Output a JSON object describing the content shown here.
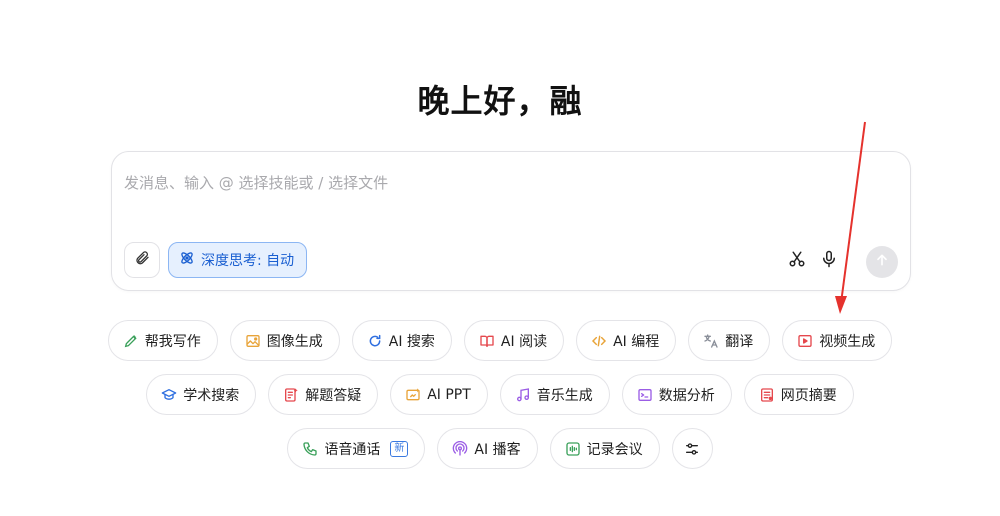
{
  "greeting": "晚上好，融",
  "composer": {
    "placeholder": "发消息、输入 @ 选择技能或 / 选择文件",
    "value": "",
    "deep_think_label": "深度思考: 自动"
  },
  "chips_row1": [
    {
      "label": "帮我写作",
      "icon": "pen-icon",
      "color": "#3aa05a"
    },
    {
      "label": "图像生成",
      "icon": "image-icon",
      "color": "#e8a43a"
    },
    {
      "label": "AI 搜索",
      "icon": "search-refresh-icon",
      "color": "#2f6fe0"
    },
    {
      "label": "AI 阅读",
      "icon": "book-icon",
      "color": "#e5484d"
    },
    {
      "label": "AI 编程",
      "icon": "code-icon",
      "color": "#e8a43a"
    },
    {
      "label": "翻译",
      "icon": "translate-icon",
      "color": "#8a8f99"
    },
    {
      "label": "视频生成",
      "icon": "video-icon",
      "color": "#e5484d"
    }
  ],
  "chips_row2": [
    {
      "label": "学术搜索",
      "icon": "graduation-cap-icon",
      "color": "#2f6fe0"
    },
    {
      "label": "解题答疑",
      "icon": "question-doc-icon",
      "color": "#e5484d"
    },
    {
      "label": "AI PPT",
      "icon": "ppt-icon",
      "color": "#e8a43a"
    },
    {
      "label": "音乐生成",
      "icon": "music-icon",
      "color": "#9b5de5"
    },
    {
      "label": "数据分析",
      "icon": "terminal-icon",
      "color": "#9b5de5"
    },
    {
      "label": "网页摘要",
      "icon": "webpage-icon",
      "color": "#e5484d"
    }
  ],
  "chips_row3": [
    {
      "label": "语音通话",
      "icon": "phone-icon",
      "color": "#3aa05a",
      "badge": "新"
    },
    {
      "label": "AI 播客",
      "icon": "podcast-icon",
      "color": "#9b5de5"
    },
    {
      "label": "记录会议",
      "icon": "meeting-icon",
      "color": "#3aa05a"
    }
  ],
  "colors": {
    "accent": "#1a5fd1",
    "annotation_arrow": "#e5322d"
  }
}
